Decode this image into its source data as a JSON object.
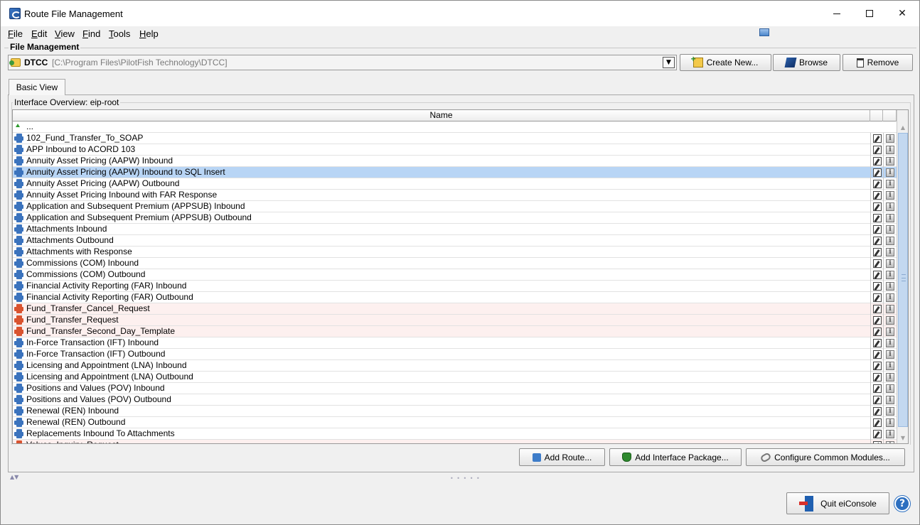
{
  "window": {
    "title": "Route File Management",
    "controls": {
      "minimize": "—",
      "maximize": "☐",
      "close": "✕"
    }
  },
  "menu": [
    {
      "underline": "F",
      "rest": "ile"
    },
    {
      "underline": "E",
      "rest": "dit"
    },
    {
      "underline": "V",
      "rest": "iew"
    },
    {
      "underline": "F",
      "rest": "ind"
    },
    {
      "underline": "T",
      "rest": "ools"
    },
    {
      "underline": "H",
      "rest": "elp"
    }
  ],
  "file_management": {
    "legend": "File Management",
    "selected_name": "DTCC",
    "selected_path": "[C:\\Program Files\\PilotFish Technology\\DTCC]",
    "create_new_label": "Create New...",
    "browse_label": "Browse",
    "remove_label": "Remove"
  },
  "tabs": {
    "basic_view": "Basic View"
  },
  "interface_overview": {
    "legend": "Interface Overview: eip-root",
    "column_name": "Name",
    "parent_row": "...",
    "rows": [
      {
        "name": "102_Fund_Transfer_To_SOAP",
        "status": "normal"
      },
      {
        "name": "APP Inbound to ACORD 103",
        "status": "normal"
      },
      {
        "name": "Annuity Asset Pricing (AAPW) Inbound",
        "status": "normal"
      },
      {
        "name": "Annuity Asset Pricing (AAPW) Inbound to SQL Insert",
        "status": "selected"
      },
      {
        "name": "Annuity Asset Pricing (AAPW) Outbound",
        "status": "normal"
      },
      {
        "name": "Annuity Asset Pricing Inbound with FAR Response",
        "status": "normal"
      },
      {
        "name": "Application and Subsequent Premium (APPSUB) Inbound",
        "status": "normal"
      },
      {
        "name": "Application and Subsequent Premium (APPSUB) Outbound",
        "status": "normal"
      },
      {
        "name": "Attachments Inbound",
        "status": "normal"
      },
      {
        "name": "Attachments Outbound",
        "status": "normal"
      },
      {
        "name": "Attachments with Response",
        "status": "normal"
      },
      {
        "name": "Commissions (COM) Inbound",
        "status": "normal"
      },
      {
        "name": "Commissions (COM) Outbound",
        "status": "normal"
      },
      {
        "name": "Financial Activity Reporting (FAR) Inbound",
        "status": "normal"
      },
      {
        "name": "Financial Activity Reporting (FAR) Outbound",
        "status": "normal"
      },
      {
        "name": "Fund_Transfer_Cancel_Request",
        "status": "warning"
      },
      {
        "name": "Fund_Transfer_Request",
        "status": "warning"
      },
      {
        "name": "Fund_Transfer_Second_Day_Template",
        "status": "warning"
      },
      {
        "name": "In-Force Transaction (IFT) Inbound",
        "status": "normal"
      },
      {
        "name": "In-Force Transaction (IFT) Outbound",
        "status": "normal"
      },
      {
        "name": "Licensing and Appointment (LNA) Inbound",
        "status": "normal"
      },
      {
        "name": "Licensing and Appointment (LNA) Outbound",
        "status": "normal"
      },
      {
        "name": "Positions and Values (POV) Inbound",
        "status": "normal"
      },
      {
        "name": "Positions and Values (POV) Outbound",
        "status": "normal"
      },
      {
        "name": "Renewal (REN) Inbound",
        "status": "normal"
      },
      {
        "name": "Renewal (REN) Outbound",
        "status": "normal"
      },
      {
        "name": "Replacements Inbound To Attachments",
        "status": "normal"
      },
      {
        "name": "Values_Inquiry_Request",
        "status": "warning"
      }
    ]
  },
  "actions": {
    "add_route": "Add Route...",
    "add_interface_package": "Add Interface Package...",
    "configure_common_modules": "Configure Common Modules..."
  },
  "footer": {
    "quit_label": "Quit eiConsole",
    "help_glyph": "?"
  },
  "colors": {
    "selected_row": "#b8d5f5",
    "warning_row": "#fdf0ef",
    "route_icon_normal": "#3b73bd",
    "route_icon_warning": "#d9532f"
  }
}
